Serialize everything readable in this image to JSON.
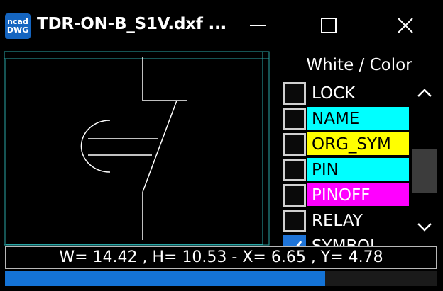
{
  "window": {
    "title": "TDR-ON-B_S1V.dxf ...",
    "app_icon_text_top": "ncad",
    "app_icon_text_bottom": "DWG",
    "buttons": [
      "minimize-icon",
      "maximize-icon",
      "close-icon"
    ]
  },
  "layer_panel": {
    "header": "White / Color",
    "items": [
      {
        "label": "LOCK",
        "checked": false,
        "bg": "#000000",
        "fg": "#ffffff"
      },
      {
        "label": "NAME",
        "checked": false,
        "bg": "#00ffff",
        "fg": "#000000"
      },
      {
        "label": "ORG_SYM",
        "checked": false,
        "bg": "#ffff00",
        "fg": "#000000"
      },
      {
        "label": "PIN",
        "checked": false,
        "bg": "#00ffff",
        "fg": "#000000"
      },
      {
        "label": "PINOFF",
        "checked": false,
        "bg": "#ff00ff",
        "fg": "#ffffff"
      },
      {
        "label": "RELAY",
        "checked": false,
        "bg": "#000000",
        "fg": "#ffffff"
      },
      {
        "label": "SYMBOL",
        "checked": true,
        "bg": "#000000",
        "fg": "#ffffff"
      }
    ],
    "scroll_icons": [
      "chevron-up-icon",
      "chevron-down-icon"
    ]
  },
  "status": {
    "text": "W= 14.42 , H= 10.53 - X= 6.65 , Y= 4.78"
  },
  "progress": {
    "fraction": 0.74
  },
  "colors": {
    "accent": "#1473d6",
    "frame": "#2aa6a6"
  }
}
